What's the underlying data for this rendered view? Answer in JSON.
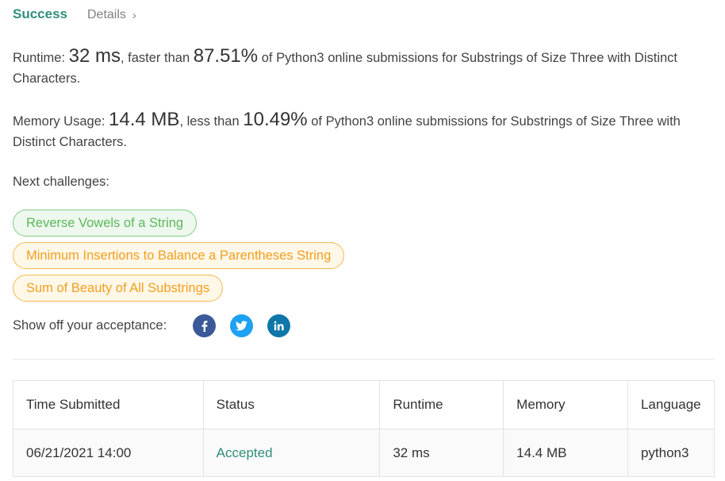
{
  "tabs": {
    "success": "Success",
    "details": "Details"
  },
  "runtime": {
    "label": "Runtime:",
    "value": "32 ms",
    "mid": ", faster than",
    "percent": "87.51%",
    "suffix": "of Python3 online submissions for Substrings of Size Three with Distinct Characters."
  },
  "memory": {
    "label": "Memory Usage:",
    "value": "14.4 MB",
    "mid": ", less than",
    "percent": "10.49%",
    "suffix": "of Python3 online submissions for Substrings of Size Three with Distinct Characters."
  },
  "next": {
    "label": "Next challenges:",
    "items": [
      {
        "title": "Reverse Vowels of a String",
        "difficulty": "easy",
        "color": "#5cb85c"
      },
      {
        "title": "Minimum Insertions to Balance a Parentheses String",
        "difficulty": "medium",
        "color": "#f0a020"
      },
      {
        "title": "Sum of Beauty of All Substrings",
        "difficulty": "medium",
        "color": "#f0a020"
      }
    ]
  },
  "share": {
    "label": "Show off your acceptance:",
    "icons": [
      "facebook-icon",
      "twitter-icon",
      "linkedin-icon"
    ]
  },
  "table": {
    "headers": [
      "Time Submitted",
      "Status",
      "Runtime",
      "Memory",
      "Language"
    ],
    "rows": [
      [
        "06/21/2021 14:00",
        "Accepted",
        "32 ms",
        "14.4 MB",
        "python3"
      ]
    ]
  },
  "colors": {
    "accent": "#2f8e7b",
    "easy": "#5cb85c",
    "medium": "#f0a020"
  }
}
